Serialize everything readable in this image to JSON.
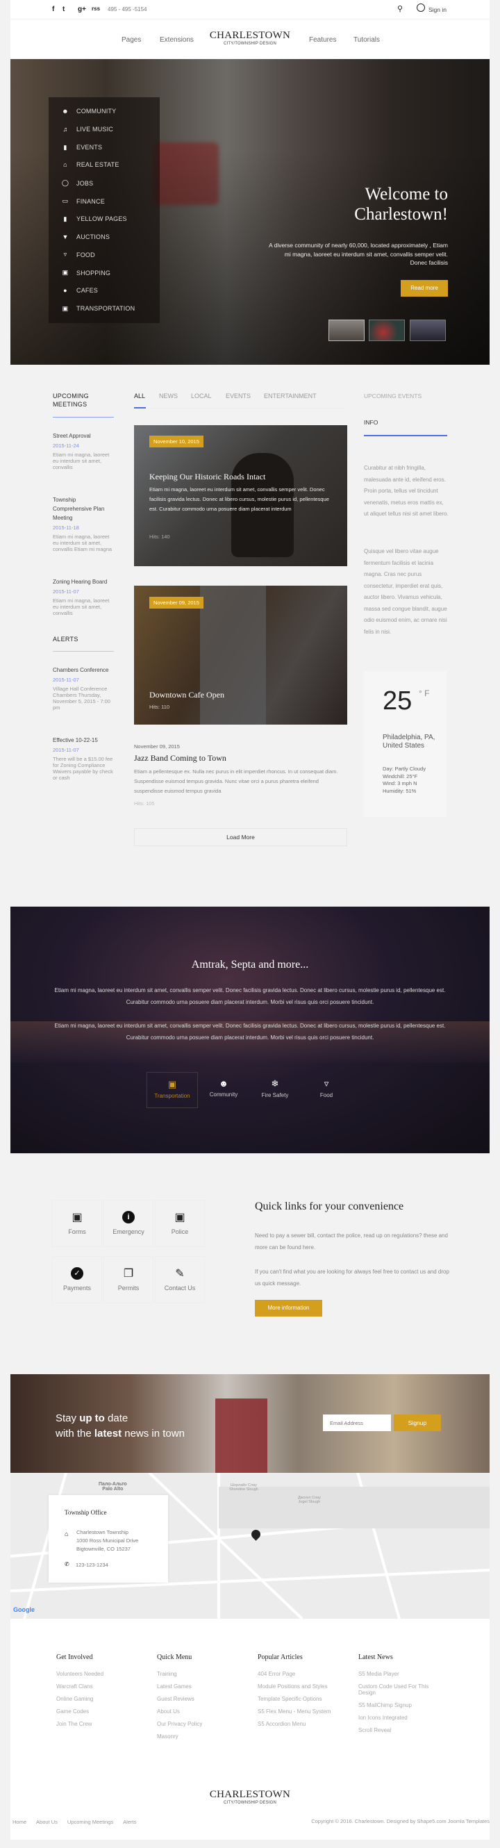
{
  "topbar": {
    "phone": "495 - 495 -5154",
    "sign_in": "Sign in",
    "social": [
      "f",
      "t",
      "g+",
      "rss"
    ]
  },
  "nav": {
    "left": [
      "Pages",
      "Extensions"
    ],
    "right": [
      "Features",
      "Tutorials"
    ],
    "logo_title": "CHARLESTOWN",
    "logo_subtitle": "CITY/TOWNSHIP DESIGN"
  },
  "hero": {
    "menu": [
      {
        "label": "COMMUNITY",
        "icon": "community-icon"
      },
      {
        "label": "LIVE MUSIC",
        "icon": "music-icon"
      },
      {
        "label": "EVENTS",
        "icon": "bookmark-icon"
      },
      {
        "label": "REAL ESTATE",
        "icon": "home-icon"
      },
      {
        "label": "JOBS",
        "icon": "circle-icon"
      },
      {
        "label": "FINANCE",
        "icon": "card-icon"
      },
      {
        "label": "YELLOW PAGES",
        "icon": "document-icon"
      },
      {
        "label": "AUCTIONS",
        "icon": "megaphone-icon"
      },
      {
        "label": "FOOD",
        "icon": "pizza-icon"
      },
      {
        "label": "SHOPPING",
        "icon": "cart-icon"
      },
      {
        "label": "CAFES",
        "icon": "teapot-icon"
      },
      {
        "label": "TRANSPORTATION",
        "icon": "train-icon"
      }
    ],
    "title_line1": "Welcome to",
    "title_line2": "Charlestown!",
    "text": "A diverse community of nearly 60,000, located approximately , Etiam mi magna, laoreet eu interdum sit amet, convallis semper velit. Donec facilisis",
    "button": "Read more"
  },
  "meetings": {
    "heading": "UPCOMING MEETINGS",
    "items": [
      {
        "title": "Street Approval",
        "date": "2015-11-24",
        "text": "Etiam mi magna, laoreet eu interdum sit amet, convallis"
      },
      {
        "title": "Township Comprehensive Plan Meeting",
        "date": "2015-11-18",
        "text": "Etiam mi magna, laoreet eu interdum sit amet, convallis Etiam mi magna"
      },
      {
        "title": "Zoning Hearing Board",
        "date": "2015-11-07",
        "text": "Etiam mi magna, laoreet eu interdum sit amet, convallis"
      }
    ]
  },
  "alerts": {
    "heading": "ALERTS",
    "items": [
      {
        "title": "Chambers Conference",
        "date": "2015-11-07",
        "text": "Village Hall Conference Chambers Thursday, November 5, 2015 - 7:00 pm"
      },
      {
        "title": "Effective 10-22-15",
        "date": "2015-11-07",
        "text": "There will be a $15.00 fee for Zoning Compliance Waivers payable by check or cash"
      }
    ]
  },
  "tabs": [
    "ALL",
    "NEWS",
    "LOCAL",
    "EVENTS",
    "ENTERTAINMENT"
  ],
  "articles": [
    {
      "date": "November 10, 2015",
      "title": "Keeping Our Historic Roads Intact",
      "text": "Etiam mi magna, laoreet eu interdum sit amet, convallis semper velit. Donec facilisis gravida lectus. Donec at libero cursus, molestie purus id, pellentesque est. Curabitur commodo urna posuere diam placerat interdum",
      "hits": "Hits: 140"
    },
    {
      "date": "November 09, 2015",
      "title": "Downtown Cafe Open",
      "hits": "Hits: 110"
    },
    {
      "date": "November 09, 2015",
      "title": "Jazz Band Coming to Town",
      "text": "Etiam a pellentesque ex. Nulla nec purus in elit imperdiet rhoncus. In ut consequat diam. Suspendisse euismod tempus gravida. Nunc vitae orci a purus pharetra eleifend suspendisse euismod tempus gravida",
      "hits": "Hits: 105"
    }
  ],
  "load_more": "Load More",
  "side": {
    "tab_events": "UPCOMING EVENTS",
    "tab_info": "INFO",
    "p1": "Curabitur at nibh fringilla, malesuada ante id, eleifend eros. Proin porta, tellus vel tincidunt venenatis, metus eros mattis ex, ut aliquet tellus nisi sit amet libero.",
    "p2": "Quisque vel libero vitae augue fermentum facilisis et lacinia magna. Cras nec purus consectetur, imperdiet erat quis, auctor libero. Vivamus vehicula, massa sed congue blandit, augue odio euismod enim, ac ornare nisi felis in nisi."
  },
  "weather": {
    "temp": "25",
    "unit": "° F",
    "location": "Philadelphia, PA, United States",
    "day": "Day: Partly Cloudy",
    "windchill": "Windchill: 25°F",
    "wind": "Wind: 3 mph N",
    "humidity": "Humidity: 51%"
  },
  "transport": {
    "title": "Amtrak, Septa and more...",
    "p1": "Etiam mi magna, laoreet eu interdum sit amet, convallis semper velit. Donec facilisis gravida lectus. Donec at libero cursus, molestie purus id, pellentesque est. Curabitur commodo urna posuere diam placerat interdum. Morbi vel risus quis orci posuere tincidunt.",
    "p2": "Etiam mi magna, laoreet eu interdum sit amet, convallis semper velit. Donec facilisis gravida lectus. Donec at libero cursus, molestie purus id, pellentesque est. Curabitur commodo urna posuere diam placerat interdum. Morbi vel risus quis orci posuere tincidunt.",
    "tabs": [
      {
        "label": "Transportation",
        "icon": "bus-icon",
        "active": true
      },
      {
        "label": "Community",
        "icon": "community-icon"
      },
      {
        "label": "Fire Safety",
        "icon": "fire-icon"
      },
      {
        "label": "Food",
        "icon": "wine-glass-icon"
      }
    ]
  },
  "quicklinks": {
    "items": [
      {
        "label": "Forms",
        "icon": "archive-box-icon"
      },
      {
        "label": "Emergency",
        "icon": "info-icon"
      },
      {
        "label": "Police",
        "icon": "lock-icon"
      },
      {
        "label": "Payments",
        "icon": "check-circle-icon"
      },
      {
        "label": "Permits",
        "icon": "documents-icon"
      },
      {
        "label": "Contact Us",
        "icon": "edit-icon"
      }
    ],
    "title": "Quick links for your convenience",
    "p1": "Need to pay a sewer bill, contact the police, read up on regulations? these and more can be found here.",
    "p2": "If you can't find what you are looking for always feel free to contact us and drop us quick message.",
    "button": "More information"
  },
  "newsletter": {
    "l1a": "Stay ",
    "l1b": "up to",
    "l1c": " date",
    "l2a": "with the ",
    "l2b": "latest",
    "l2c": " news in town",
    "placeholder": "Email Address",
    "button": "Signup"
  },
  "map": {
    "office_title": "Township Office",
    "addr1": "Charlestown Township",
    "addr2": "1000 Ross Municipal Drive",
    "addr3": "Bigtownville, CO 15237",
    "phone": "123-123-1234",
    "city_ru": "Пало-Альто",
    "city": "Palo Alto",
    "label1": "Шорлайн Слау",
    "label1b": "Shoreline Slough",
    "label2": "Джогел Слау",
    "label2b": "Jogel Slough",
    "google": "Google"
  },
  "footer": {
    "cols": [
      {
        "title": "Get Involved",
        "items": [
          "Volunteers Needed",
          "Warcraft Clans",
          "Online Gaming",
          "Game Codes",
          "Join The Crew"
        ]
      },
      {
        "title": "Quick Menu",
        "items": [
          "Training",
          "Latest Games",
          "Guest Reviews",
          "About Us",
          "Our Privacy Policy",
          "Masonry"
        ]
      },
      {
        "title": "Popular Articles",
        "items": [
          "404 Error Page",
          "Module Positions and Styles",
          "Template Specific Options",
          "S5 Flex Menu - Menu System",
          "S5 Accordion Menu"
        ]
      },
      {
        "title": "Latest News",
        "items": [
          "S5 Media Player",
          "Custom Code Used For This Design",
          "S5 MailChimp Signup",
          "Ion Icons Integrated",
          "Scroll Reveal"
        ]
      }
    ],
    "links": [
      "Home",
      "About Us",
      "Upcoming Meetings",
      "Alerts"
    ],
    "copyright": "Copyright © 2016. Charlestown. Designed by Shape5.com Joomla Templates"
  },
  "colors": {
    "gold": "#d59f1e",
    "blue": "#4a6cf7"
  }
}
